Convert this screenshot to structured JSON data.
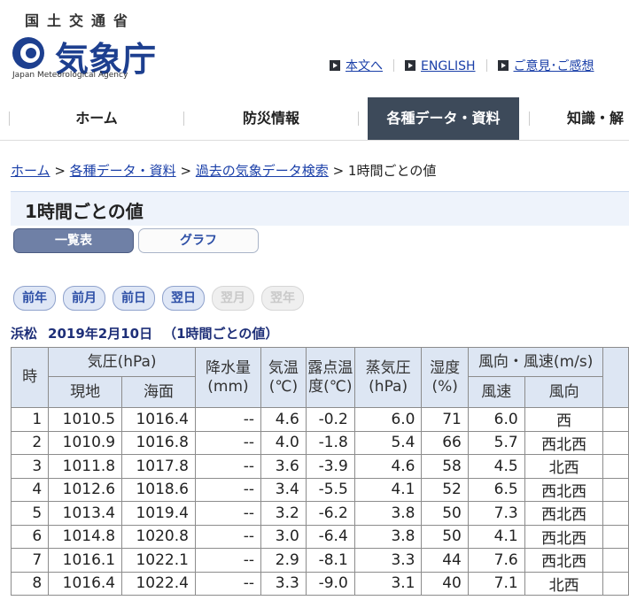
{
  "header": {
    "ministry": "国土交通省",
    "agency": "気象庁",
    "agency_en": "Japan Meteorological Agency",
    "links": [
      "本文へ",
      "ENGLISH",
      "ご意見･ご感想"
    ]
  },
  "nav": {
    "items": [
      "ホーム",
      "防災情報",
      "各種データ・資料",
      "知識・解"
    ],
    "active_index": 2
  },
  "breadcrumb": {
    "links": [
      "ホーム",
      "各種データ・資料",
      "過去の気象データ検索"
    ],
    "current": "1時間ごとの値",
    "sep": " > "
  },
  "page": {
    "title": "1時間ごとの値",
    "tabs": [
      "一覧表",
      "グラフ"
    ]
  },
  "day_nav": [
    {
      "label": "前年",
      "enabled": true
    },
    {
      "label": "前月",
      "enabled": true
    },
    {
      "label": "前日",
      "enabled": true
    },
    {
      "label": "翌日",
      "enabled": true
    },
    {
      "label": "翌月",
      "enabled": false
    },
    {
      "label": "翌年",
      "enabled": false
    }
  ],
  "data_header": {
    "station": "浜松",
    "date": "2019年2月10日",
    "note": "（1時間ごとの値）"
  },
  "table": {
    "h_time": "時",
    "h_pressure": "気圧(hPa)",
    "h_station": "現地",
    "h_sea": "海面",
    "h_precip": "降水量(mm)",
    "h_temp": "気温(℃)",
    "h_dew": "露点温度(℃)",
    "h_vapor": "蒸気圧(hPa)",
    "h_humidity": "湿度(%)",
    "h_wind": "風向・風速(m/s)",
    "h_speed": "風速",
    "h_dir": "風向",
    "rows": [
      [
        "1",
        "1010.5",
        "1016.4",
        "--",
        "4.6",
        "-0.2",
        "6.0",
        "71",
        "6.0",
        "西"
      ],
      [
        "2",
        "1010.9",
        "1016.8",
        "--",
        "4.0",
        "-1.8",
        "5.4",
        "66",
        "5.7",
        "西北西"
      ],
      [
        "3",
        "1011.8",
        "1017.8",
        "--",
        "3.6",
        "-3.9",
        "4.6",
        "58",
        "4.5",
        "北西"
      ],
      [
        "4",
        "1012.6",
        "1018.6",
        "--",
        "3.4",
        "-5.5",
        "4.1",
        "52",
        "6.5",
        "西北西"
      ],
      [
        "5",
        "1013.4",
        "1019.4",
        "--",
        "3.2",
        "-6.2",
        "3.8",
        "50",
        "7.3",
        "西北西"
      ],
      [
        "6",
        "1014.8",
        "1020.8",
        "--",
        "3.0",
        "-6.4",
        "3.8",
        "50",
        "4.1",
        "西北西"
      ],
      [
        "7",
        "1016.1",
        "1022.1",
        "--",
        "2.9",
        "-8.1",
        "3.3",
        "44",
        "7.6",
        "西北西"
      ],
      [
        "8",
        "1016.4",
        "1022.4",
        "--",
        "3.3",
        "-9.0",
        "3.1",
        "40",
        "7.1",
        "北西"
      ]
    ]
  }
}
